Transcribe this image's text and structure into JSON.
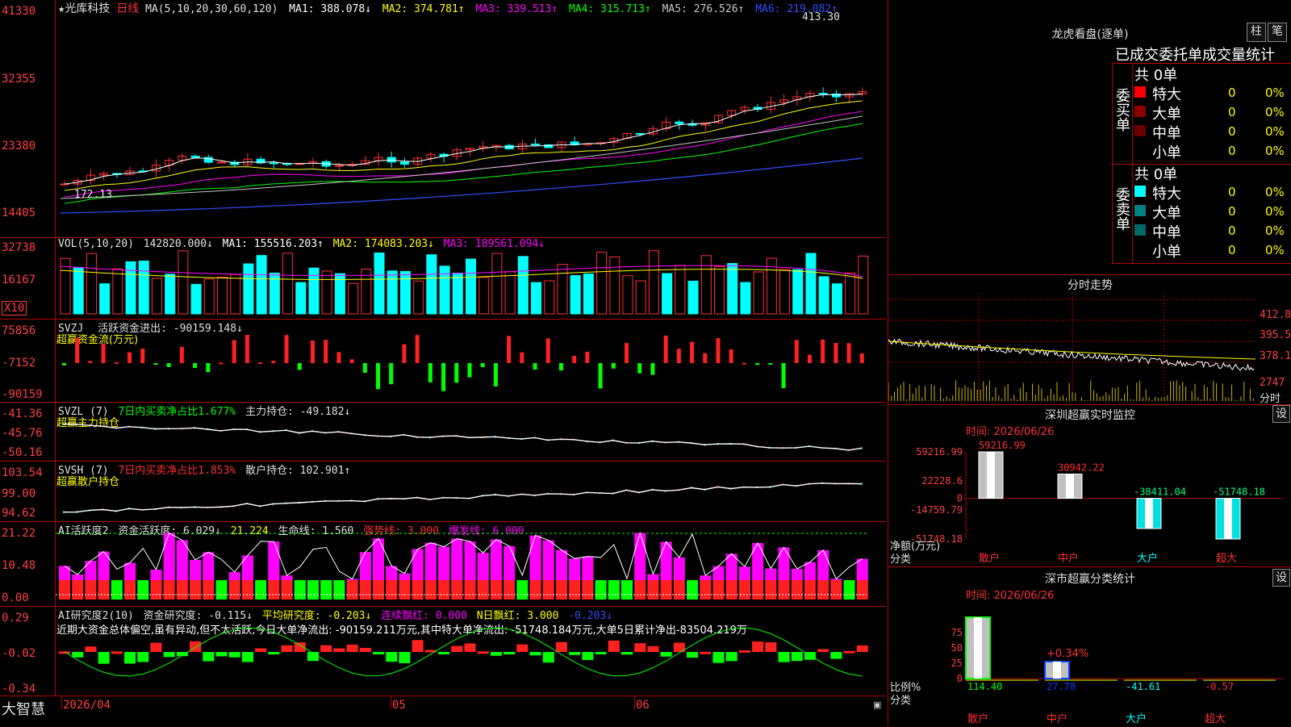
{
  "main": {
    "stock_name": "★光库科技",
    "period": "日线",
    "ma_params": "MA(5,10,20,30,60,120)",
    "ma": [
      {
        "label": "MA1: 388.078↓",
        "color": "#ffffff"
      },
      {
        "label": "MA2: 374.781↑",
        "color": "#ffff00"
      },
      {
        "label": "MA3: 339.513↑",
        "color": "#ff00ff"
      },
      {
        "label": "MA4: 315.713↑",
        "color": "#00ff00"
      },
      {
        "label": "MA5: 276.526↑",
        "color": "#c8c8c8"
      },
      {
        "label": "MA6: 219.082↑",
        "color": "#3050ff"
      }
    ],
    "y_labels": [
      "41330",
      "32355",
      "23380",
      "14405"
    ],
    "high_label": "413.30",
    "low_label": "172.13"
  },
  "vol": {
    "params": "VOL(5,10,20)",
    "value": "142820.000↓",
    "ma": [
      {
        "label": "MA1: 155516.203↑",
        "color": "#ffffff"
      },
      {
        "label": "MA2: 174083.203↓",
        "color": "#ffff00"
      },
      {
        "label": "MA3: 189561.094↓",
        "color": "#ff00ff"
      }
    ],
    "y_labels": [
      "32738",
      "16167"
    ],
    "unit": "X10"
  },
  "svzj": {
    "name": "SVZJ",
    "text": "活跃资金进出: -90159.148↓",
    "sub": "超赢资金流(万元)",
    "y_labels": [
      "75856",
      "-7152",
      "-90159"
    ]
  },
  "svzl": {
    "name": "SVZL (7)",
    "text1": "7日内买卖净占比1.677%",
    "text2": "主力持仓: -49.182↓",
    "sub": "超赢主力持仓",
    "y_labels": [
      "-41.36",
      "-45.76",
      "-50.16"
    ]
  },
  "svsh": {
    "name": "SVSH (7)",
    "text1": "7日内买卖净占比1.853%",
    "text2": "散户持仓: 102.901↑",
    "sub": "超赢散户持仓",
    "y_labels": [
      "103.54",
      "99.00",
      "94.62"
    ]
  },
  "ai1": {
    "name": "AI活跃度2",
    "text": "资金活跃度: 6.029↓",
    "v2": "21.224",
    "life": "生命线: 1.560",
    "strong": "强势线: 3.000",
    "burst": "爆发线: 6.000",
    "y_labels": [
      "21.22",
      "10.48",
      "0.00"
    ]
  },
  "ai2": {
    "name": "AI研究度2(10)",
    "t1": "资金研究度: -0.115↓",
    "t2": "平均研究度: -0.203↓",
    "t3": "连续飘红: 0.000",
    "t4": "N日飘红: 3.000",
    "t5": "-0.203↓",
    "note": "近期大资金总体偏空,虽有异动,但不太活跃,今日大单净流出: -90159.211万元,其中特大单净流出: -51748.184万元,大单5日累计净出-83504.219万",
    "y_labels": [
      "0.29",
      "-0.02",
      "-0.34"
    ]
  },
  "bottom": {
    "brand": "大智慧",
    "dates": [
      "2026/04",
      "05",
      "06"
    ]
  },
  "right": {
    "lhkp_title": "龙虎看盘(逐单)",
    "btn1": "柱",
    "btn2": "笔",
    "tabs": "已成交委托单成交量统计",
    "buy": {
      "side": "委买单",
      "count": "共 0单",
      "rows": [
        {
          "name": "特大",
          "val": "0",
          "pct": "0%",
          "color": "#ff0000"
        },
        {
          "name": "大单",
          "val": "0",
          "pct": "0%",
          "color": "#8b0000"
        },
        {
          "name": "中单",
          "val": "0",
          "pct": "0%",
          "color": "#6a0000"
        },
        {
          "name": "小单",
          "val": "0",
          "pct": "0%",
          "color": "#000000"
        }
      ]
    },
    "sell": {
      "side": "委卖单",
      "count": "共 0单",
      "rows": [
        {
          "name": "特大",
          "val": "0",
          "pct": "0%",
          "color": "#00ffff"
        },
        {
          "name": "大单",
          "val": "0",
          "pct": "0%",
          "color": "#008080"
        },
        {
          "name": "中单",
          "val": "0",
          "pct": "0%",
          "color": "#006868"
        },
        {
          "name": "小单",
          "val": "0",
          "pct": "0%",
          "color": "#000000"
        }
      ]
    },
    "minute": {
      "title": "分时走势",
      "labels": [
        "412.8",
        "395.5",
        "378.1",
        "2747"
      ],
      "fen": "分时"
    },
    "sz_monitor": {
      "title": "深圳超赢实时监控",
      "btn": "设",
      "time": "时间: 2026/06/26",
      "y_labels": [
        "59216.99",
        "22228.6",
        "0",
        "-14759.79",
        "-51748.18"
      ],
      "ylabel": "净额(万元)",
      "xlabel": "分类",
      "bars": [
        {
          "cat": "散户",
          "value": 59216.99,
          "label": "59216.99"
        },
        {
          "cat": "中户",
          "value": 30942.22,
          "label": "30942.22"
        },
        {
          "cat": "大户",
          "value": -38411.04,
          "label": "-38411.04"
        },
        {
          "cat": "超大",
          "value": -51748.18,
          "label": "-51748.18"
        }
      ]
    },
    "sz_class": {
      "title": "深市超赢分类统计",
      "btn": "设",
      "time": "时间: 2026/06/26",
      "y_labels": [
        "75",
        "50",
        "25",
        "0"
      ],
      "ylabel": "比例%",
      "xlabel": "分类",
      "note": "+0.34%",
      "bars": [
        {
          "cat": "散户",
          "value": 114.4,
          "label": "114.40",
          "color": "#00ff00"
        },
        {
          "cat": "中户",
          "value": 27.78,
          "label": "27.78",
          "color": "#0040ff"
        },
        {
          "cat": "大户",
          "value": -41.61,
          "label": "-41.61",
          "color": "#00ffff"
        },
        {
          "cat": "超大",
          "value": -0.57,
          "label": "-0.57",
          "color": "#ff3030"
        }
      ]
    }
  }
}
